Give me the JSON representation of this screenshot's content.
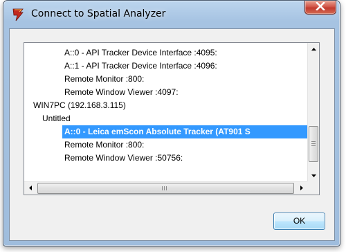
{
  "window": {
    "title": "Connect to Spatial Analyzer",
    "icon": "spatial-analyzer-app-icon",
    "close_icon": "close-x-icon"
  },
  "list": {
    "rows": [
      {
        "label": "A::0 - API Tracker Device Interface  :4095:",
        "level": 2,
        "selected": false
      },
      {
        "label": "A::1 - API Tracker Device Interface  :4096:",
        "level": 2,
        "selected": false
      },
      {
        "label": "Remote Monitor  :800:",
        "level": 2,
        "selected": false
      },
      {
        "label": "Remote Window Viewer  :4097:",
        "level": 2,
        "selected": false
      },
      {
        "label": "WIN7PC (192.168.3.115)",
        "level": 0,
        "selected": false
      },
      {
        "label": "Untitled",
        "level": 1,
        "selected": false
      },
      {
        "label": "A::0 - Leica emScon Absolute Tracker (AT901 S",
        "level": 2,
        "selected": true
      },
      {
        "label": "Remote Monitor  :800:",
        "level": 2,
        "selected": false
      },
      {
        "label": "Remote Window Viewer  :50756:",
        "level": 2,
        "selected": false
      }
    ],
    "selection_color": "#3399ff"
  },
  "buttons": {
    "ok": "OK"
  }
}
